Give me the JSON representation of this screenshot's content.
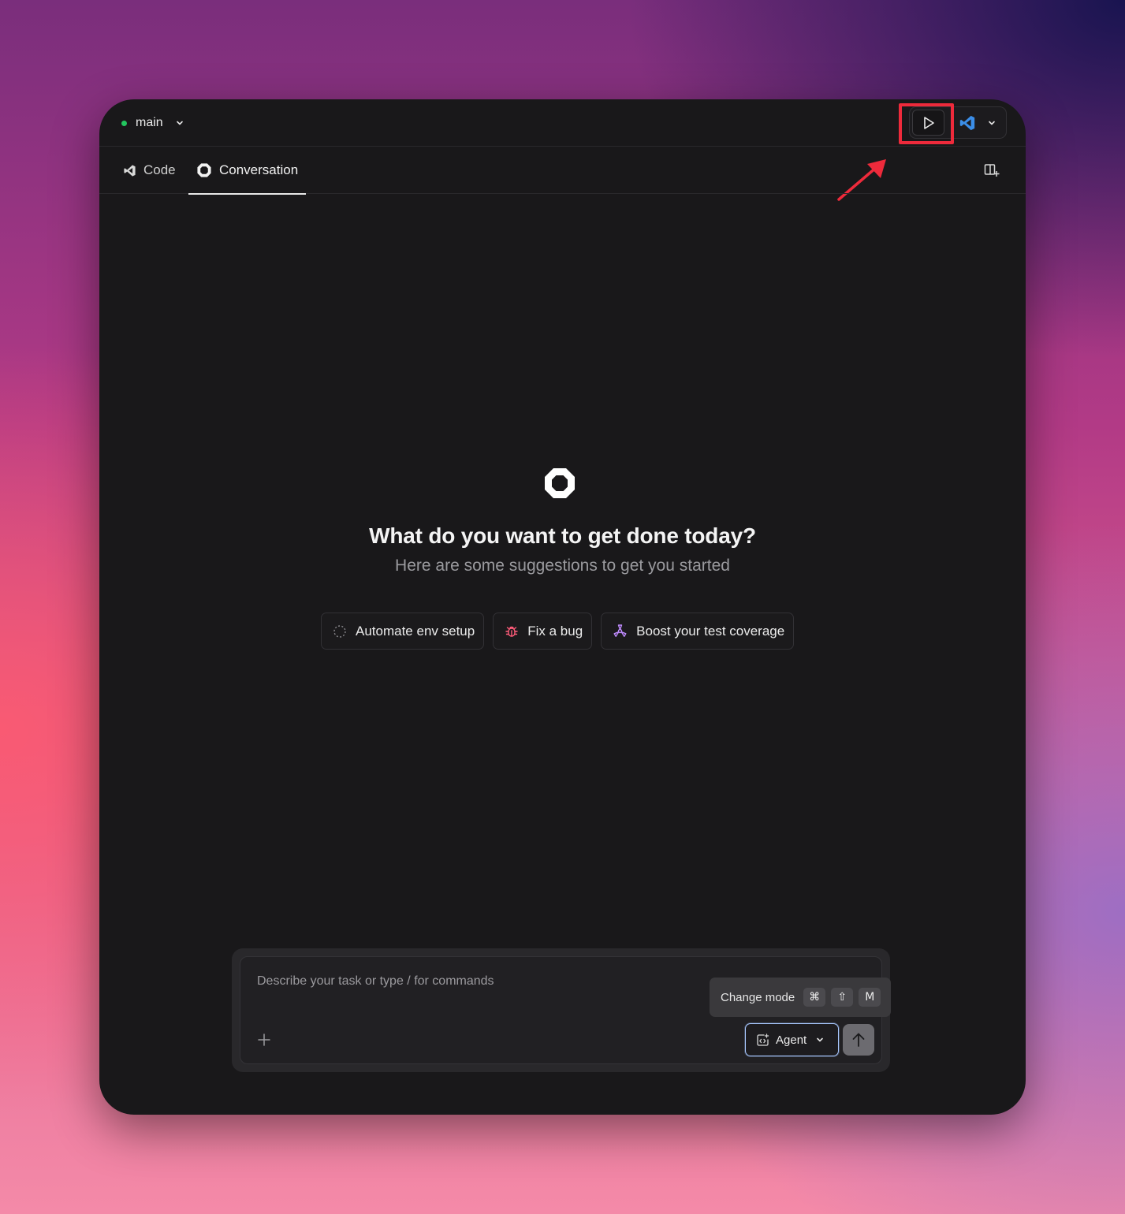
{
  "topbar": {
    "branch_name": "main",
    "branch_status_color": "#22c55e",
    "run_button_icon": "play-icon",
    "editor_icon": "vscode-icon"
  },
  "annotation": {
    "highlight_color": "#ee2a3b",
    "arrow_color": "#ee2a3b"
  },
  "tabs": [
    {
      "label": "Code",
      "icon": "vscode-icon",
      "active": false
    },
    {
      "label": "Conversation",
      "icon": "conversation-logo-icon",
      "active": true
    }
  ],
  "hero": {
    "title": "What do you want to get done today?",
    "subtitle": "Here are some suggestions to get you started"
  },
  "suggestions": [
    {
      "label": "Automate env setup",
      "icon": "dashed-circle-icon"
    },
    {
      "label": "Fix a bug",
      "icon": "bug-icon",
      "icon_color": "#ff5c7a"
    },
    {
      "label": "Boost your test coverage",
      "icon": "test-flask-icon",
      "icon_color": "#c08cff"
    }
  ],
  "composer": {
    "placeholder": "Describe your task or type / for commands",
    "value": "",
    "tooltip": {
      "label": "Change mode",
      "keys": [
        "⌘",
        "⇧",
        "M"
      ]
    },
    "mode_label": "Agent",
    "accent_color": "#a8c7ff"
  }
}
